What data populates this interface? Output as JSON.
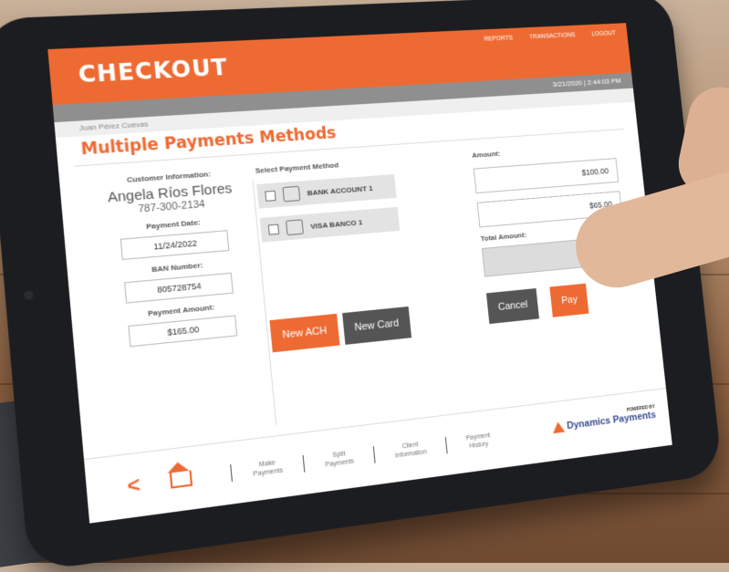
{
  "app": {
    "brand": "CHECKOUT",
    "nav": [
      "REPORTS",
      "TRANSACTIONS",
      "LOGOUT"
    ],
    "datetime": "3/21/2020  |  2:44:03 PM",
    "user": "Juan Pérez Cuevas",
    "page_title": "Multiple Payments Methods"
  },
  "customer": {
    "info_label": "Customer Information:",
    "name": "Angela Ríos Flores",
    "phone": "787-300-2134",
    "date_label": "Payment Date:",
    "date_value": "11/24/2022",
    "ban_label": "BAN Number:",
    "ban_value": "805728754",
    "amount_label": "Payment Amount:",
    "amount_value": "$165.00"
  },
  "methods": {
    "label": "Select Payment Method",
    "items": [
      "BANK ACCOUNT 1",
      "VISA BANCO 1"
    ],
    "new_ach": "New ACH",
    "new_card": "New Card"
  },
  "amounts": {
    "label": "Amount:",
    "values": [
      "$100.00",
      "$65.00"
    ],
    "total_label": "Total Amount:",
    "total_value": "$16",
    "cancel": "Cancel",
    "pay": "Pay"
  },
  "footer": {
    "items": [
      {
        "line1": "Make",
        "line2": "Payments"
      },
      {
        "line1": "Split",
        "line2": "Payments"
      },
      {
        "line1": "Client",
        "line2": "Information"
      },
      {
        "line1": "Payment",
        "line2": "History"
      }
    ],
    "powered": "POWERED BY",
    "logo": "Dynamics Payments"
  },
  "colors": {
    "accent": "#ee6a33",
    "dark": "#555555",
    "logo": "#3c4c8f"
  }
}
